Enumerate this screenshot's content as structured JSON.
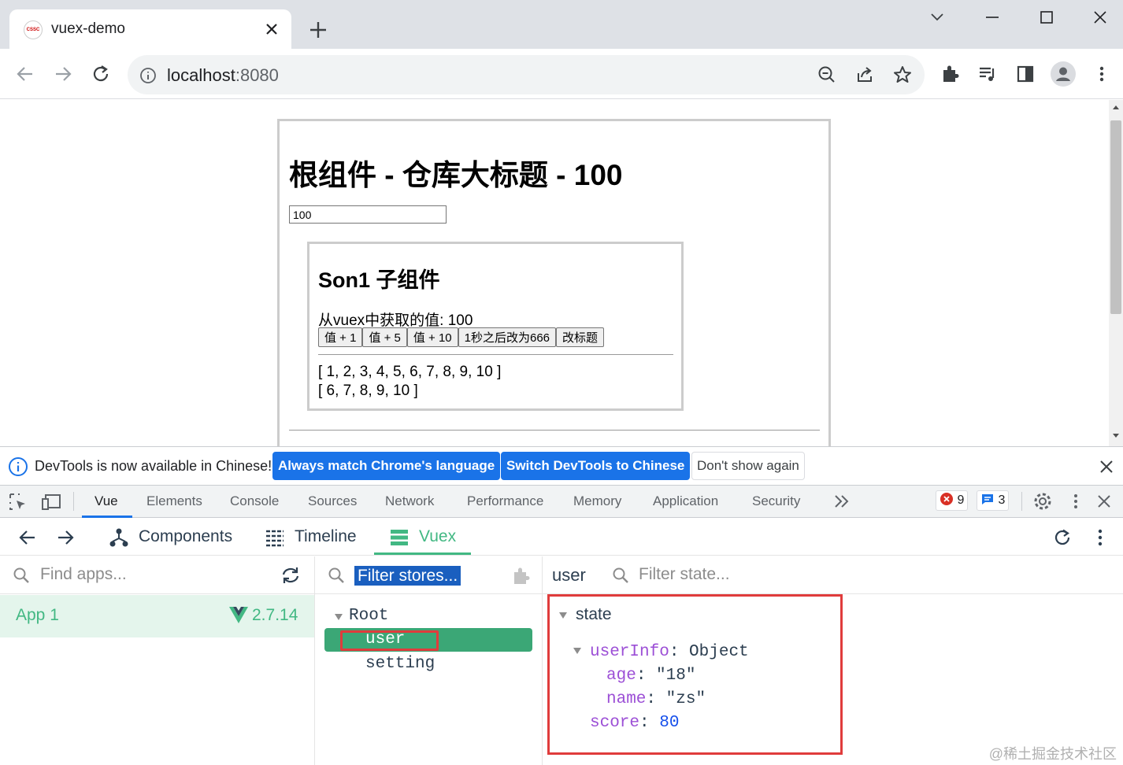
{
  "browser": {
    "tab_title": "vuex-demo",
    "favicon_text": "CSSC",
    "url_host": "localhost",
    "url_port": ":8080"
  },
  "page": {
    "root_title": "根组件 - 仓库大标题 - 100",
    "root_input_value": "100",
    "son_title": "Son1 子组件",
    "son_value_text": "从vuex中获取的值: 100",
    "buttons": [
      "值 + 1",
      "值 + 5",
      "值 + 10",
      "1秒之后改为666",
      "改标题"
    ],
    "list1": "[ 1, 2, 3, 4, 5, 6, 7, 8, 9, 10 ]",
    "list2": "[ 6, 7, 8, 9, 10 ]"
  },
  "infobar": {
    "message": "DevTools is now available in Chinese!",
    "btn_match": "Always match Chrome's language",
    "btn_switch": "Switch DevTools to Chinese",
    "btn_dismiss": "Don't show again"
  },
  "devtools": {
    "tabs": [
      "Vue",
      "Elements",
      "Console",
      "Sources",
      "Network",
      "Performance",
      "Memory",
      "Application",
      "Security"
    ],
    "active_tab": "Vue",
    "error_count": "9",
    "message_count": "3"
  },
  "vue": {
    "nav": {
      "components": "Components",
      "timeline": "Timeline",
      "vuex": "Vuex"
    },
    "active_nav": "Vuex",
    "apps_placeholder": "Find apps...",
    "app_name": "App 1",
    "app_version": "2.7.14",
    "stores_filter": "Filter stores...",
    "stores": {
      "root": "Root",
      "user": "user",
      "setting": "setting"
    },
    "selected_store": "user",
    "state_module": "user",
    "state_placeholder": "Filter state...",
    "state_label": "state",
    "state": {
      "userInfo_key": "userInfo",
      "userInfo_type": "Object",
      "age_key": "age",
      "age_value": "\"18\"",
      "name_key": "name",
      "name_value": "\"zs\"",
      "score_key": "score",
      "score_value": "80"
    }
  },
  "watermark": "@稀土掘金技术社区",
  "colors": {
    "vue_green": "#42b883",
    "selected_store_bg": "#3ba776",
    "highlight_red": "#e03c3c",
    "chrome_blue": "#1a73e8"
  }
}
